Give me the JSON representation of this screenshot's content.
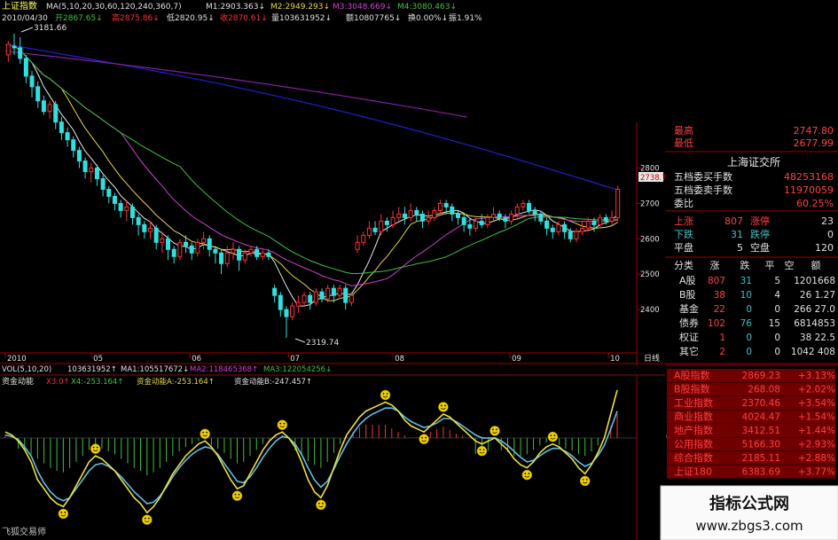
{
  "header": {
    "title": "上证指数",
    "ma_label": "MA(5,10,20,30,60,120,240,360,7)",
    "m1": "M1:2903.363↓",
    "m2": "M2:2949.293↓",
    "m3": "M3:3048.669↓",
    "m4": "M4:3080.463↓",
    "date": "2010/04/30",
    "open": "开2867.65↓",
    "high": "高2875.86↓",
    "low": "低2820.95↓",
    "close": "收2870.61↓",
    "volume": "量103631952↓",
    "amount": "额10807765↓",
    "change": "换0.00%↓",
    "amplitude": "振1.91%"
  },
  "annotations": {
    "high_point": "3181.66",
    "low_point": "2319.74",
    "current_price": "2738.7"
  },
  "volume_header": {
    "vol": "VOL(5,10,20)",
    "vol_value": "103631952↑",
    "ma1": "MA1:105517672↓",
    "ma2": "MA2:118465368↑",
    "ma3": "MA3:122054256↓"
  },
  "indicator_header": {
    "name": "资金动能",
    "x3": "X3:0↑",
    "x4": "X4:-253.164↑",
    "a": "资金动能A:-253.164↑",
    "b": "资金动能B:-247.457↑"
  },
  "watermark": {
    "author": "飞狐交易师",
    "site_name": "指标公式网",
    "site_url": "www.zbgs3.com"
  },
  "side_panel": {
    "top": [
      {
        "label": "最高",
        "value": "2747.80"
      },
      {
        "label": "最低",
        "value": "2677.99"
      }
    ],
    "exchange": "上海证交所",
    "orders": [
      {
        "label": "五档委买手数",
        "value": "48253168"
      },
      {
        "label": "五档委卖手数",
        "value": "11970059"
      },
      {
        "label": "委比",
        "value": "60.25%"
      }
    ],
    "breadth": [
      {
        "l1": "上涨",
        "v1": "807",
        "l2": "涨停",
        "v2": "23"
      },
      {
        "l1": "下跌",
        "v1": "31",
        "l2": "跌停",
        "v2": "0"
      },
      {
        "l1": "平盘",
        "v1": "5",
        "l2": "空盘",
        "v2": "120"
      }
    ],
    "class_headers": [
      "分类",
      "涨",
      "跌",
      "平",
      "空",
      "额"
    ],
    "classes": [
      {
        "name": "A股",
        "up": "807",
        "down": "31",
        "flat": "5",
        "amt": "1201668"
      },
      {
        "name": "B股",
        "up": "38",
        "down": "10",
        "flat": "4",
        "amt": "26 1.27"
      },
      {
        "name": "基金",
        "up": "22",
        "down": "0",
        "flat": "0",
        "amt": "266 27.0"
      },
      {
        "name": "债券",
        "up": "102",
        "down": "76",
        "flat": "15",
        "amt": "6814853"
      },
      {
        "name": "权证",
        "up": "1",
        "down": "0",
        "flat": "0",
        "amt": "38 22.5"
      },
      {
        "name": "其它",
        "up": "2",
        "down": "0",
        "flat": "0",
        "amt": "1042 408"
      }
    ],
    "indices": [
      {
        "name": "A股指数",
        "value": "2869.23",
        "change": "+3.13%"
      },
      {
        "name": "B股指数",
        "value": "268.08",
        "change": "+2.02%"
      },
      {
        "name": "工业指数",
        "value": "2370.46",
        "change": "+3.54%"
      },
      {
        "name": "商业指数",
        "value": "4024.47",
        "change": "+1.54%"
      },
      {
        "name": "地产指数",
        "value": "3412.51",
        "change": "+1.44%"
      },
      {
        "name": "公用指数",
        "value": "5166.30",
        "change": "+2.93%"
      },
      {
        "name": "综合指数",
        "value": "2185.11",
        "change": "+2.88%"
      },
      {
        "name": "上证180",
        "value": "6383.69",
        "change": "+3.77%"
      }
    ]
  },
  "colors": {
    "up": "#ff3030",
    "down": "#30e0e0",
    "ma_white": "#e8e8e8",
    "ma_yellow": "#e8d840",
    "ma_magenta": "#d040d0",
    "ma_green": "#40c040",
    "ma_blue": "#2020d0",
    "ma_purple": "#8020a0",
    "line_a": "#f0e040",
    "line_b": "#60c0e0",
    "axis": "#a00000"
  },
  "chart_data": [
    {
      "type": "candlestick",
      "title": "上证指数",
      "x_ticks": [
        "2010",
        "05",
        "06",
        "07",
        "08",
        "09",
        "10"
      ],
      "x_unit": "日线",
      "y_ticks": [
        2400,
        2500,
        2600,
        2700,
        2800
      ],
      "ylim": [
        2310,
        3200
      ],
      "candles": [
        [
          3120,
          3150,
          3100,
          3160
        ],
        [
          3145,
          3140,
          3120,
          3180
        ],
        [
          3140,
          3110,
          3095,
          3170
        ],
        [
          3110,
          3060,
          3040,
          3120
        ],
        [
          3060,
          3030,
          3000,
          3075
        ],
        [
          3030,
          2990,
          2970,
          3045
        ],
        [
          2990,
          2960,
          2950,
          3005
        ],
        [
          2960,
          2980,
          2940,
          2990
        ],
        [
          2980,
          2930,
          2910,
          2990
        ],
        [
          2930,
          2900,
          2880,
          2945
        ],
        [
          2900,
          2880,
          2860,
          2915
        ],
        [
          2880,
          2850,
          2830,
          2890
        ],
        [
          2850,
          2820,
          2800,
          2860
        ],
        [
          2820,
          2790,
          2770,
          2830
        ],
        [
          2790,
          2800,
          2760,
          2815
        ],
        [
          2800,
          2770,
          2750,
          2810
        ],
        [
          2770,
          2740,
          2720,
          2780
        ],
        [
          2740,
          2720,
          2700,
          2750
        ],
        [
          2720,
          2700,
          2680,
          2730
        ],
        [
          2700,
          2680,
          2660,
          2710
        ],
        [
          2680,
          2690,
          2650,
          2710
        ],
        [
          2690,
          2660,
          2640,
          2700
        ],
        [
          2660,
          2640,
          2610,
          2670
        ],
        [
          2640,
          2620,
          2600,
          2650
        ],
        [
          2620,
          2630,
          2600,
          2650
        ],
        [
          2630,
          2590,
          2570,
          2640
        ],
        [
          2590,
          2600,
          2560,
          2620
        ],
        [
          2600,
          2570,
          2540,
          2610
        ],
        [
          2570,
          2550,
          2530,
          2580
        ],
        [
          2550,
          2590,
          2540,
          2600
        ],
        [
          2590,
          2580,
          2560,
          2610
        ],
        [
          2580,
          2560,
          2540,
          2590
        ],
        [
          2560,
          2590,
          2550,
          2600
        ],
        [
          2590,
          2600,
          2570,
          2620
        ],
        [
          2600,
          2570,
          2550,
          2610
        ],
        [
          2570,
          2560,
          2530,
          2580
        ],
        [
          2560,
          2530,
          2500,
          2570
        ],
        [
          2530,
          2560,
          2520,
          2580
        ],
        [
          2560,
          2570,
          2540,
          2590
        ],
        [
          2570,
          2540,
          2510,
          2580
        ],
        [
          2540,
          2560,
          2530,
          2570
        ],
        [
          2560,
          2570,
          2550,
          2580
        ],
        [
          2570,
          2550,
          2540,
          2580
        ],
        [
          2550,
          2560,
          2540,
          2570
        ],
        [
          2560,
          2550,
          2540,
          2570
        ],
        [
          2460,
          2440,
          2420,
          2470
        ],
        [
          2440,
          2400,
          2380,
          2450
        ],
        [
          2400,
          2380,
          2320,
          2410
        ],
        [
          2380,
          2410,
          2370,
          2420
        ],
        [
          2410,
          2420,
          2390,
          2440
        ],
        [
          2420,
          2440,
          2410,
          2450
        ],
        [
          2440,
          2420,
          2400,
          2450
        ],
        [
          2420,
          2450,
          2410,
          2460
        ],
        [
          2450,
          2430,
          2420,
          2460
        ],
        [
          2430,
          2460,
          2420,
          2470
        ],
        [
          2460,
          2440,
          2420,
          2470
        ],
        [
          2440,
          2460,
          2430,
          2470
        ],
        [
          2460,
          2420,
          2400,
          2470
        ],
        [
          2420,
          2440,
          2410,
          2450
        ],
        [
          2570,
          2590,
          2560,
          2610
        ],
        [
          2590,
          2610,
          2580,
          2620
        ],
        [
          2610,
          2630,
          2600,
          2650
        ],
        [
          2630,
          2620,
          2610,
          2650
        ],
        [
          2620,
          2650,
          2610,
          2670
        ],
        [
          2650,
          2640,
          2620,
          2660
        ],
        [
          2640,
          2660,
          2630,
          2680
        ],
        [
          2660,
          2670,
          2650,
          2690
        ],
        [
          2670,
          2660,
          2640,
          2690
        ],
        [
          2660,
          2680,
          2650,
          2700
        ],
        [
          2680,
          2670,
          2650,
          2690
        ],
        [
          2670,
          2650,
          2630,
          2680
        ],
        [
          2650,
          2660,
          2640,
          2680
        ],
        [
          2660,
          2680,
          2650,
          2690
        ],
        [
          2680,
          2700,
          2670,
          2710
        ],
        [
          2700,
          2690,
          2670,
          2710
        ],
        [
          2690,
          2670,
          2650,
          2700
        ],
        [
          2670,
          2660,
          2640,
          2680
        ],
        [
          2660,
          2640,
          2620,
          2670
        ],
        [
          2640,
          2630,
          2610,
          2660
        ],
        [
          2630,
          2650,
          2620,
          2660
        ],
        [
          2650,
          2640,
          2630,
          2670
        ],
        [
          2640,
          2660,
          2630,
          2670
        ],
        [
          2660,
          2670,
          2650,
          2690
        ],
        [
          2670,
          2660,
          2650,
          2680
        ],
        [
          2660,
          2650,
          2630,
          2670
        ],
        [
          2650,
          2670,
          2640,
          2680
        ],
        [
          2670,
          2690,
          2660,
          2700
        ],
        [
          2690,
          2700,
          2680,
          2710
        ],
        [
          2700,
          2680,
          2670,
          2710
        ],
        [
          2680,
          2670,
          2650,
          2690
        ],
        [
          2670,
          2650,
          2640,
          2680
        ],
        [
          2650,
          2630,
          2610,
          2660
        ],
        [
          2630,
          2620,
          2600,
          2640
        ],
        [
          2620,
          2640,
          2610,
          2650
        ],
        [
          2640,
          2620,
          2600,
          2650
        ],
        [
          2620,
          2600,
          2590,
          2630
        ],
        [
          2600,
          2620,
          2590,
          2630
        ],
        [
          2620,
          2630,
          2610,
          2650
        ],
        [
          2630,
          2650,
          2620,
          2660
        ],
        [
          2650,
          2640,
          2620,
          2660
        ],
        [
          2640,
          2660,
          2630,
          2670
        ],
        [
          2660,
          2650,
          2640,
          2670
        ],
        [
          2650,
          2660,
          2640,
          2680
        ],
        [
          2660,
          2740,
          2650,
          2750
        ]
      ]
    },
    {
      "type": "line",
      "title": "资金动能",
      "series": [
        {
          "name": "资金动能A",
          "values": [
            20,
            10,
            -10,
            -40,
            -80,
            -140,
            -170,
            -200,
            -220,
            -230,
            -200,
            -160,
            -120,
            -80,
            -60,
            -70,
            -90,
            -110,
            -140,
            -170,
            -200,
            -220,
            -250,
            -230,
            -200,
            -160,
            -120,
            -90,
            -60,
            -40,
            -20,
            -10,
            -30,
            -60,
            -100,
            -140,
            -170,
            -160,
            -120,
            -80,
            -40,
            -10,
            10,
            20,
            0,
            -30,
            -80,
            -140,
            -180,
            -200,
            -160,
            -100,
            -40,
            10,
            40,
            70,
            90,
            100,
            110,
            120,
            110,
            90,
            60,
            40,
            30,
            20,
            40,
            60,
            80,
            70,
            50,
            30,
            10,
            -10,
            -20,
            -10,
            0,
            -20,
            -40,
            -70,
            -90,
            -100,
            -80,
            -50,
            -30,
            -20,
            -30,
            -50,
            -70,
            -100,
            -120,
            -90,
            -50,
            0,
            80,
            160
          ]
        },
        {
          "name": "资金动能B",
          "values": [
            10,
            5,
            -5,
            -30,
            -60,
            -110,
            -150,
            -180,
            -200,
            -210,
            -200,
            -170,
            -140,
            -110,
            -90,
            -85,
            -95,
            -110,
            -130,
            -155,
            -180,
            -200,
            -220,
            -215,
            -195,
            -165,
            -130,
            -100,
            -75,
            -55,
            -40,
            -30,
            -35,
            -55,
            -85,
            -115,
            -145,
            -150,
            -130,
            -100,
            -65,
            -35,
            -10,
            5,
            0,
            -20,
            -55,
            -100,
            -140,
            -165,
            -145,
            -105,
            -60,
            -20,
            15,
            45,
            65,
            80,
            90,
            100,
            100,
            90,
            70,
            55,
            45,
            35,
            40,
            50,
            65,
            65,
            55,
            40,
            25,
            10,
            0,
            0,
            0,
            -10,
            -25,
            -45,
            -65,
            -80,
            -75,
            -60,
            -45,
            -35,
            -35,
            -45,
            -60,
            -80,
            -95,
            -85,
            -60,
            -25,
            30,
            90
          ]
        }
      ],
      "ylim": [
        -300,
        160
      ],
      "zero_label": "0"
    }
  ]
}
